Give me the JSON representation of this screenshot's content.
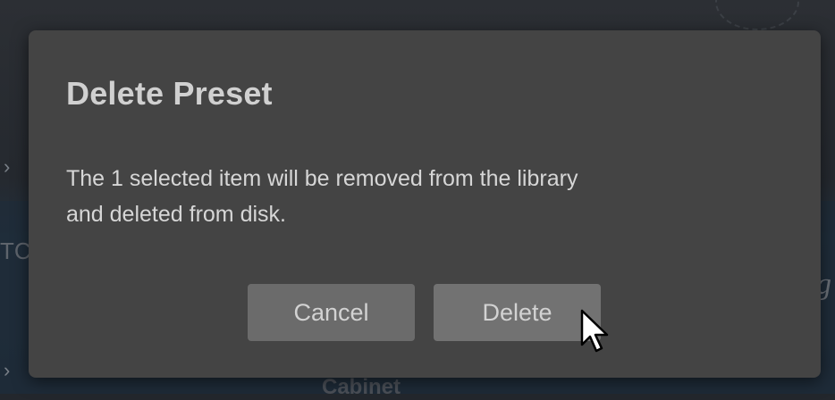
{
  "dialog": {
    "title": "Delete Preset",
    "message_line1": "The 1 selected item will be removed from the library",
    "message_line2": "and deleted from disk.",
    "cancel_label": "Cancel",
    "delete_label": "Delete"
  },
  "background": {
    "bottom_label": "Cabinet",
    "edge_text": "TC",
    "chevron": "›"
  },
  "icons": {
    "cursor": "arrow-cursor-icon"
  },
  "colors": {
    "dialog_bg": "#444444",
    "button_bg": "#6b6b6b",
    "text": "#d6d6d6"
  }
}
